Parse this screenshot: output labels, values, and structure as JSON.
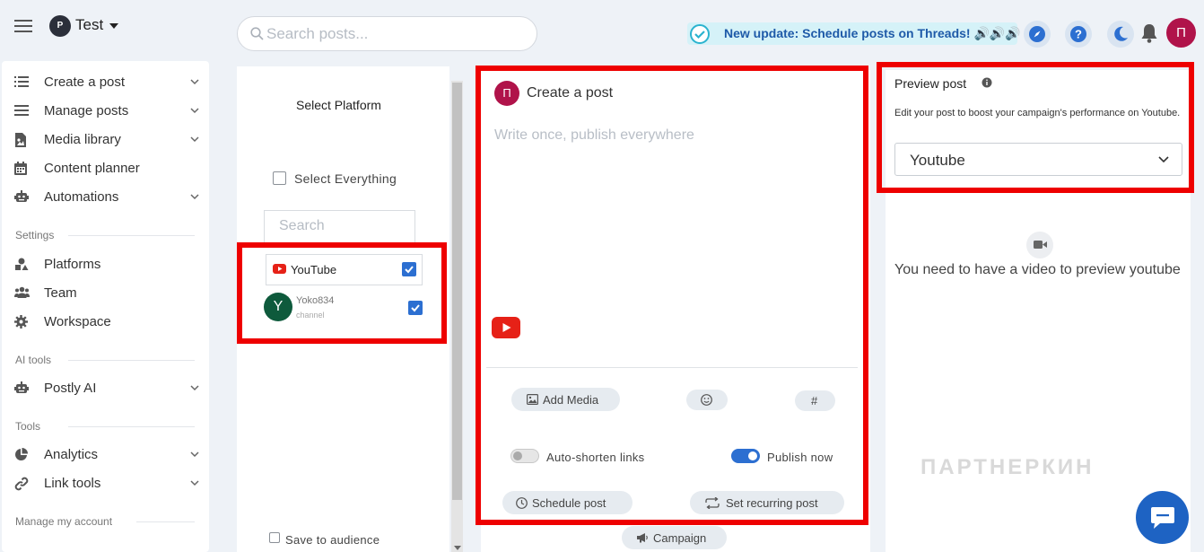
{
  "topbar": {
    "workspace_initial": "P",
    "workspace_name": "Test",
    "search_placeholder": "Search posts...",
    "update_text": "New update: Schedule posts on Threads! 🔊🔊🔊",
    "user_initial": "П"
  },
  "sidebar": {
    "items": [
      {
        "label": "Create a post",
        "icon": "list-icon"
      },
      {
        "label": "Manage posts",
        "icon": "menu-icon"
      },
      {
        "label": "Media library",
        "icon": "file-image-icon"
      },
      {
        "label": "Content planner",
        "icon": "calendar-icon"
      },
      {
        "label": "Automations",
        "icon": "robot-icon"
      }
    ],
    "settings_label": "Settings",
    "settings_items": [
      {
        "label": "Platforms",
        "icon": "shapes-icon"
      },
      {
        "label": "Team",
        "icon": "users-icon"
      },
      {
        "label": "Workspace",
        "icon": "gear-icon"
      }
    ],
    "ai_label": "AI tools",
    "ai_items": [
      {
        "label": "Postly AI",
        "icon": "robot-icon"
      }
    ],
    "tools_label": "Tools",
    "tools_items": [
      {
        "label": "Analytics",
        "icon": "pie-chart-icon"
      },
      {
        "label": "Link tools",
        "icon": "link-icon"
      }
    ],
    "account_label": "Manage my account"
  },
  "platform_panel": {
    "title": "Select Platform",
    "select_all": "Select Everything",
    "search_placeholder": "Search",
    "platform_name": "YouTube",
    "account_initial": "Y",
    "account_name": "Yoko834",
    "account_type": "channel",
    "save_to_audience": "Save to audience"
  },
  "create_post": {
    "user_initial": "П",
    "title": "Create a post",
    "placeholder": "Write once, publish everywhere",
    "add_media": "Add Media",
    "hashtag": "#",
    "auto_shorten": "Auto-shorten links",
    "publish_now": "Publish now",
    "schedule_post": "Schedule post",
    "recurring_post": "Set recurring post",
    "campaign": "Campaign"
  },
  "preview": {
    "title": "Preview post",
    "description": "Edit your post to boost your campaign's performance on Youtube.",
    "selected_platform": "Youtube",
    "message": "You need to have a video to preview youtube"
  },
  "watermark": "ПАРТНЕРКИН",
  "colors": {
    "accent": "#2c6fd1",
    "highlight": "#ee0000",
    "avatar": "#b0134a",
    "youtube": "#e62117"
  }
}
